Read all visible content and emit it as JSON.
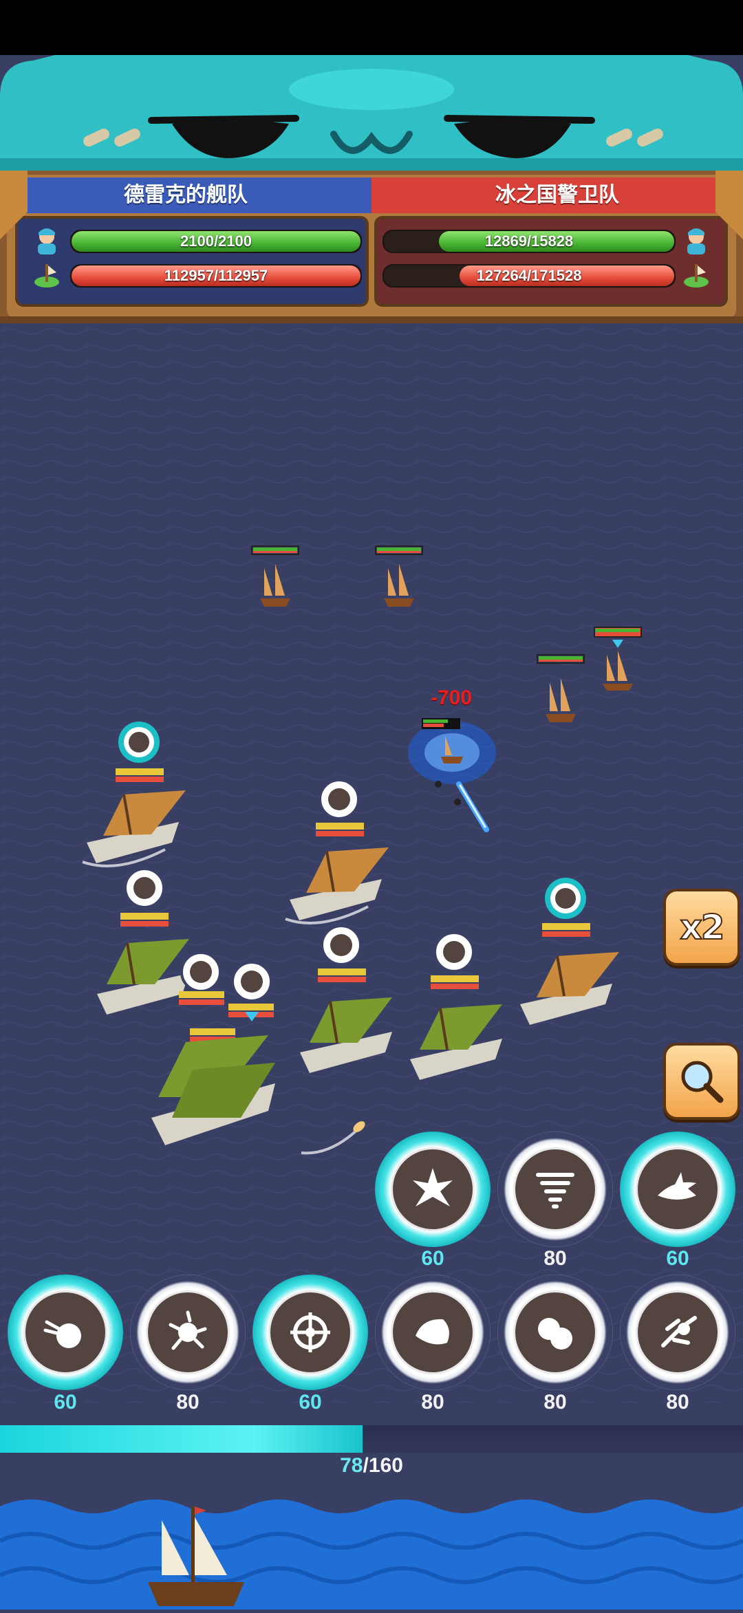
{
  "left_team": {
    "name": "德雷克的舰队",
    "crew_hp": "2100/2100",
    "crew_fraction": 1.0,
    "ship_hp": "112957/112957",
    "ship_fraction": 1.0
  },
  "right_team": {
    "name": "冰之国警卫队",
    "crew_hp": "12869/15828",
    "crew_fraction": 0.81,
    "ship_hp": "127264/171528",
    "ship_fraction": 0.74
  },
  "battle": {
    "damage_popup": "-700"
  },
  "controls": {
    "speed_label": "x2"
  },
  "skills_top": [
    {
      "icon": "burst-star-icon",
      "cost": "60",
      "state": "ready"
    },
    {
      "icon": "tornado-icon",
      "cost": "80",
      "state": "cooldown"
    },
    {
      "icon": "shark-icon",
      "cost": "60",
      "state": "ready"
    }
  ],
  "skills_bottom": [
    {
      "icon": "cannonball-icon",
      "cost": "60",
      "state": "ready"
    },
    {
      "icon": "storm-orb-icon",
      "cost": "80",
      "state": "cooldown"
    },
    {
      "icon": "wheel-icon",
      "cost": "60",
      "state": "ready"
    },
    {
      "icon": "shell-icon",
      "cost": "80",
      "state": "cooldown"
    },
    {
      "icon": "bomb-icon",
      "cost": "80",
      "state": "cooldown"
    },
    {
      "icon": "blast-icon",
      "cost": "80",
      "state": "cooldown"
    }
  ],
  "energy": {
    "current": "78",
    "max": "/160",
    "fraction": 0.4875
  },
  "colors": {
    "ready_cyan": "#1cbfc6",
    "enemy_red": "#e74e3c",
    "hp_green": "#48b432",
    "sea": "#393e63",
    "left_banner": "#3a5cb8",
    "right_banner": "#d8403a"
  }
}
